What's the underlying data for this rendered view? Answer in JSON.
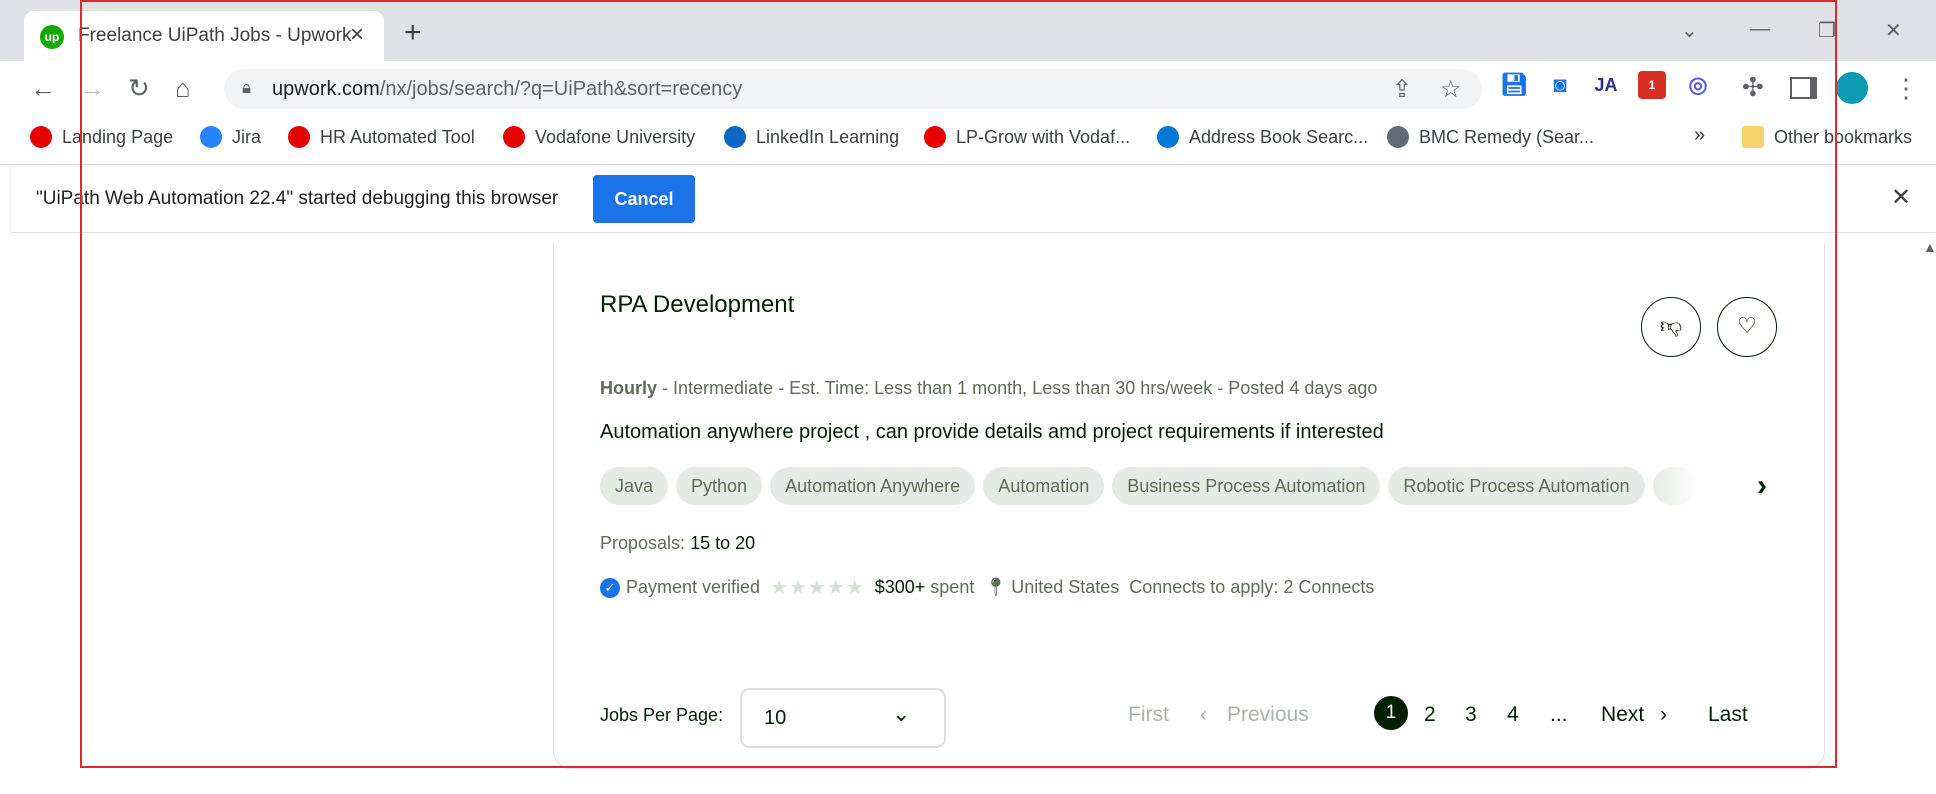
{
  "browser": {
    "tab_title": "Freelance UiPath Jobs - Upwork",
    "tab_favicon_text": "up",
    "url_host": "upwork.com",
    "url_path": "/nx/jobs/search/?q=UiPath&sort=recency",
    "extensions": [
      {
        "name": "save-extension-icon",
        "label": "",
        "color": "#1a73e8"
      },
      {
        "name": "screenshot-extension-icon",
        "label": "",
        "color": "#1a73e8"
      },
      {
        "name": "ja-extension-icon",
        "label": "JA",
        "color": "#2b2c87"
      },
      {
        "name": "notes-extension-icon",
        "label": "1",
        "color": "#d93025"
      },
      {
        "name": "sync-extension-icon",
        "label": "",
        "color": "#5b5ee6"
      }
    ]
  },
  "bookmarks": {
    "items": [
      {
        "label": "Landing Page",
        "color": "#e60000"
      },
      {
        "label": "Jira",
        "color": "#2684ff"
      },
      {
        "label": "HR Automated Tool",
        "color": "#e60000"
      },
      {
        "label": "Vodafone University",
        "color": "#e60000"
      },
      {
        "label": "LinkedIn Learning",
        "color": "#0a66c2"
      },
      {
        "label": "LP-Grow with Vodaf...",
        "color": "#e60000"
      },
      {
        "label": "Address Book Searc...",
        "color": "#0078d4"
      },
      {
        "label": "BMC Remedy (Sear...",
        "color": "#5f6b7a"
      }
    ],
    "overflow": "»",
    "other": "Other bookmarks"
  },
  "infobar": {
    "message": "\"UiPath Web Automation 22.4\" started debugging this browser",
    "cancel_label": "Cancel"
  },
  "job": {
    "title": "RPA Development",
    "meta_type": "Hourly",
    "meta_rest": " - Intermediate - Est. Time: Less than 1 month, Less than 30 hrs/week - Posted 4 days ago",
    "description": "Automation anywhere project , can provide details amd project requirements if interested",
    "skills": [
      "Java",
      "Python",
      "Automation Anywhere",
      "Automation",
      "Business Process Automation",
      "Robotic Process Automation"
    ],
    "proposals_label": "Proposals:",
    "proposals_value": "15 to 20",
    "payment_verified": "Payment verified",
    "rating": 0,
    "spent_amount": "$300+",
    "spent_label": "spent",
    "location": "United States",
    "connects_label": "Connects to apply:",
    "connects_value": "2 Connects"
  },
  "pagination": {
    "jobs_per_page_label": "Jobs Per Page:",
    "jobs_per_page_value": "10",
    "first": "First",
    "previous": "Previous",
    "pages": [
      "1",
      "2",
      "3",
      "4"
    ],
    "active_page": "1",
    "ellipsis": "...",
    "next": "Next",
    "last": "Last"
  },
  "colors": {
    "upwork_dark": "#001e00",
    "upwork_muted": "#5e6d55",
    "chrome_blue": "#1a73e8",
    "highlight_border": "#e0282e"
  }
}
